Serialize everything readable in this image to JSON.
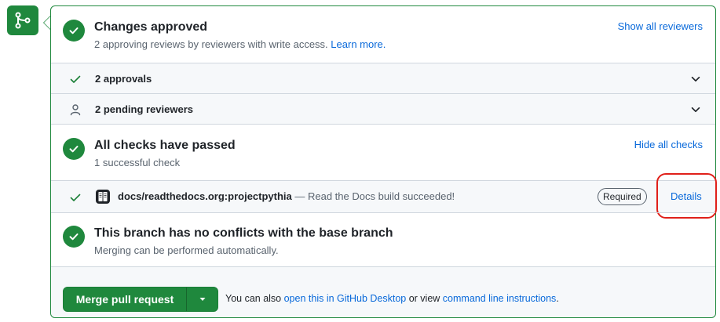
{
  "approved": {
    "title": "Changes approved",
    "subtitle": "2 approving reviews by reviewers with write access.",
    "learn_more": "Learn more.",
    "show_all": "Show all reviewers"
  },
  "approvals_row": {
    "label": "2 approvals"
  },
  "pending_row": {
    "label": "2 pending reviewers"
  },
  "checks": {
    "title": "All checks have passed",
    "subtitle": "1 successful check",
    "hide_all": "Hide all checks",
    "item": {
      "name": "docs/readthedocs.org:projectpythia",
      "description": " — Read the Docs build succeeded!",
      "badge": "Required",
      "details": "Details"
    }
  },
  "conflicts": {
    "title": "This branch has no conflicts with the base branch",
    "subtitle": "Merging can be performed automatically."
  },
  "merge": {
    "button_label": "Merge pull request",
    "note_prefix": "You can also ",
    "desktop_link": "open this in GitHub Desktop",
    "note_middle": " or view ",
    "cli_link": "command line instructions",
    "note_suffix": "."
  },
  "colors": {
    "success": "#1f883d",
    "link": "#0969da",
    "highlight": "#e0201a"
  }
}
